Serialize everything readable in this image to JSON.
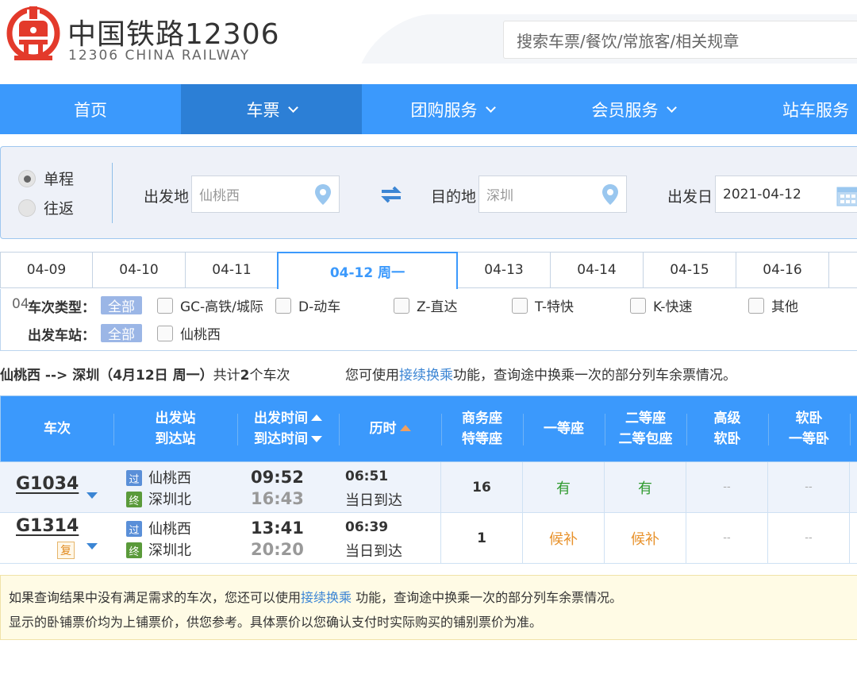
{
  "header": {
    "brand_cn": "中国铁路12306",
    "brand_en": "12306 CHINA RAILWAY",
    "search_placeholder": "搜索车票/餐饮/常旅客/相关规章"
  },
  "nav": {
    "items": [
      {
        "label": "首页"
      },
      {
        "label": "车票"
      },
      {
        "label": "团购服务"
      },
      {
        "label": "会员服务"
      },
      {
        "label": "站车服务"
      }
    ]
  },
  "query": {
    "trip_type": {
      "one_way": "单程",
      "round_trip": "往返"
    },
    "from_label": "出发地",
    "from_value": "仙桃西",
    "to_label": "目的地",
    "to_value": "深圳",
    "date_label": "出发日",
    "date_value": "2021-04-12"
  },
  "date_tabs": [
    "04-09",
    "04-10",
    "04-11",
    "04-12 周一",
    "04-13",
    "04-14",
    "04-15",
    "04-16"
  ],
  "filters": {
    "train_type_label": "车次类型：",
    "train_type_ghost": "04",
    "all": "全部",
    "types": [
      "GC-高铁/城际",
      "D-动车",
      "Z-直达",
      "T-特快",
      "K-快速",
      "其他"
    ],
    "station_label": "出发车站：",
    "stations": [
      "仙桃西"
    ]
  },
  "summary": {
    "route": "仙桃西 --> 深圳（4月12日  周一）",
    "count_pre": "共计",
    "count": "2",
    "count_post": "个车次",
    "hint_pre": "您可使用",
    "hint_link": "接续换乘",
    "hint_post": "功能，查询途中换乘一次的部分列车余票情况。"
  },
  "table": {
    "headers": {
      "train": "车次",
      "stations_1": "出发站",
      "stations_2": "到达站",
      "times_1": "出发时间",
      "times_2": "到达时间",
      "duration": "历时",
      "business_1": "商务座",
      "business_2": "特等座",
      "first": "一等座",
      "second_1": "二等座",
      "second_2": "二等包座",
      "soft_high_1": "高级",
      "soft_high_2": "软卧",
      "soft_1": "软卧",
      "soft_2": "一等卧"
    },
    "rows": [
      {
        "train": "G1034",
        "badge": "",
        "from_tag": "过",
        "from": "仙桃西",
        "to_tag": "终",
        "to": "深圳北",
        "dep": "09:52",
        "arr": "16:43",
        "duration": "06:51",
        "arrive_note": "当日到达",
        "business": "16",
        "first": "有",
        "second": "有",
        "soft_high": "--",
        "soft": "--"
      },
      {
        "train": "G1314",
        "badge": "复",
        "from_tag": "过",
        "from": "仙桃西",
        "to_tag": "终",
        "to": "深圳北",
        "dep": "13:41",
        "arr": "20:20",
        "duration": "06:39",
        "arrive_note": "当日到达",
        "business": "1",
        "first": "候补",
        "second": "候补",
        "soft_high": "--",
        "soft": "--"
      }
    ]
  },
  "notice": {
    "line1_pre": "如果查询结果中没有满足需求的车次，您还可以使用",
    "line1_link": "接续换乘",
    "line1_post": " 功能，查询途中换乘一次的部分列车余票情况。",
    "line2": "显示的卧铺票价均为上铺票价，供您参考。具体票价以您确认支付时实际购买的铺别票价为准。"
  }
}
